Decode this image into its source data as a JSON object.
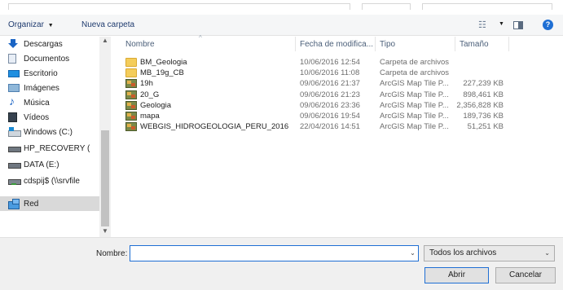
{
  "toolbar": {
    "organize_label": "Organizar",
    "organize_caret": "▼",
    "new_folder_label": "Nueva carpeta",
    "view_icon": "view-options-icon",
    "help_label": "?"
  },
  "navigation": {
    "items": [
      {
        "label": "Descargas",
        "icon": "downloads-icon"
      },
      {
        "label": "Documentos",
        "icon": "documents-icon"
      },
      {
        "label": "Escritorio",
        "icon": "desktop-icon"
      },
      {
        "label": "Imágenes",
        "icon": "pictures-icon"
      },
      {
        "label": "Música",
        "icon": "music-icon"
      },
      {
        "label": "Vídeos",
        "icon": "videos-icon"
      },
      {
        "label": "Windows (C:)",
        "icon": "windows-drive-icon"
      },
      {
        "label": "HP_RECOVERY (",
        "icon": "drive-icon"
      },
      {
        "label": "DATA (E:)",
        "icon": "drive-icon"
      },
      {
        "label": "cdspij$ (\\\\srvfile",
        "icon": "network-drive-icon"
      },
      {
        "label": "Red",
        "icon": "network-icon",
        "selected": true
      }
    ]
  },
  "file_list": {
    "columns": [
      "Nombre",
      "Fecha de modifica...",
      "Tipo",
      "Tamaño"
    ],
    "rows": [
      {
        "name": "BM_Geologia",
        "date": "10/06/2016 12:54",
        "type": "Carpeta de archivos",
        "size": "",
        "icon": "folder-icon"
      },
      {
        "name": "MB_19g_CB",
        "date": "10/06/2016 11:08",
        "type": "Carpeta de archivos",
        "size": "",
        "icon": "folder-icon"
      },
      {
        "name": "19h",
        "date": "09/06/2016 21:37",
        "type": "ArcGIS Map Tile P...",
        "size": "227,239 KB",
        "icon": "tile-package-icon"
      },
      {
        "name": "20_G",
        "date": "09/06/2016 21:23",
        "type": "ArcGIS Map Tile P...",
        "size": "898,461 KB",
        "icon": "tile-package-icon"
      },
      {
        "name": "Geologia",
        "date": "09/06/2016 23:36",
        "type": "ArcGIS Map Tile P...",
        "size": "2,356,828 KB",
        "icon": "tile-package-icon"
      },
      {
        "name": "mapa",
        "date": "09/06/2016 19:54",
        "type": "ArcGIS Map Tile P...",
        "size": "189,736 KB",
        "icon": "tile-package-icon"
      },
      {
        "name": "WEBGIS_HIDROGEOLOGIA_PERU_2016",
        "date": "22/04/2016 14:51",
        "type": "ArcGIS Map Tile P...",
        "size": "51,251 KB",
        "icon": "tile-package-icon"
      }
    ]
  },
  "footer": {
    "filename_label": "Nombre:",
    "filename_value": "",
    "filter_value": "Todos los archivos",
    "open_label": "Abrir",
    "cancel_label": "Cancelar"
  },
  "colors": {
    "accent": "#1f6fd4",
    "folder": "#f4cd5b",
    "selection": "#d9d9d9"
  }
}
